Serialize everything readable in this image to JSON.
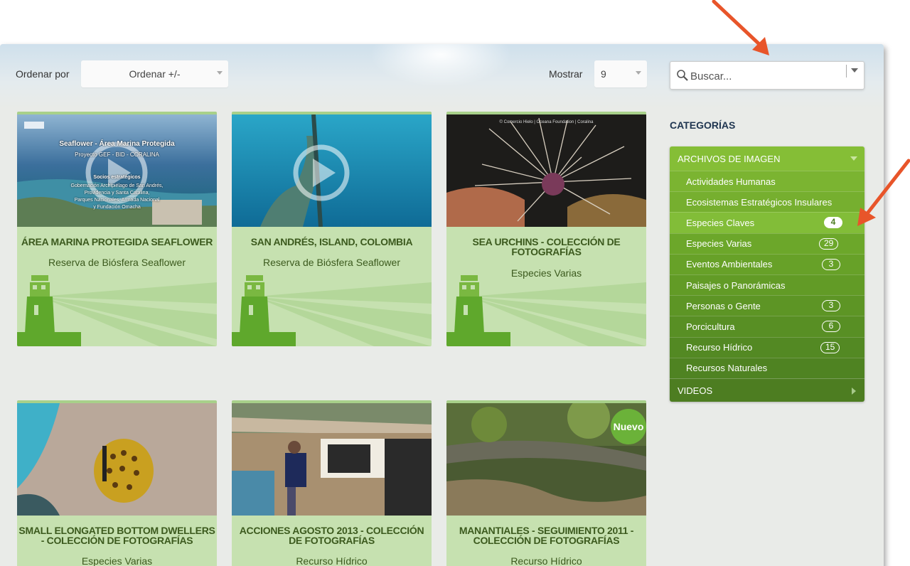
{
  "toolbar": {
    "sort_label": "Ordenar por",
    "sort_value": "Ordenar +/-",
    "show_label": "Mostrar",
    "show_value": "9",
    "search_placeholder": "Buscar..."
  },
  "sidebar": {
    "title": "CATEGORÍAS",
    "group_images": "ARCHIVOS DE IMAGEN",
    "items": [
      {
        "label": "Actividades Humanas",
        "count": ""
      },
      {
        "label": "Ecosistemas Estratégicos Insulares",
        "count": ""
      },
      {
        "label": "Especies Claves",
        "count": "4"
      },
      {
        "label": "Especies Varias",
        "count": "29"
      },
      {
        "label": "Eventos Ambientales",
        "count": "3"
      },
      {
        "label": "Paisajes o Panorámicas",
        "count": ""
      },
      {
        "label": "Personas o Gente",
        "count": "3"
      },
      {
        "label": "Porcicultura",
        "count": "6"
      },
      {
        "label": "Recurso Hídrico",
        "count": "15"
      },
      {
        "label": "Recursos Naturales",
        "count": ""
      }
    ],
    "group_videos": "VIDEOS"
  },
  "cards": [
    {
      "title": "ÁREA MARINA PROTEGIDA SEAFLOWER",
      "subtitle": "Reserva de Biósfera Seaflower",
      "overlay": {
        "title": "Seaflower - Área Marina Protegida",
        "project": "Proyecto GEF - BID - CORALINA",
        "partners_heading": "Socios estratégicos",
        "partners_1": "Gobernación Archipiélago de San Andrés,",
        "partners_2": "Providencia y Santa Catalina,",
        "partners_3": "Parques Nacionales, Armada Nacional",
        "partners_4": "y Fundación Omacha"
      }
    },
    {
      "title": "SAN ANDRÉS, ISLAND, COLOMBIA",
      "subtitle": "Reserva de Biósfera Seaflower"
    },
    {
      "title": "SEA URCHINS - COLECCIÓN DE FOTOGRAFÍAS",
      "subtitle": "Especies Varias",
      "overlay_credit": "© Comercio Hielo | Oceana Foundation | Coralina"
    },
    {
      "title": "SMALL ELONGATED BOTTOM DWELLERS - COLECCIÓN DE FOTOGRAFÍAS",
      "subtitle": "Especies Varias"
    },
    {
      "title": "ACCIONES AGOSTO 2013 - COLECCIÓN DE FOTOGRAFÍAS",
      "subtitle": "Recurso Hídrico"
    },
    {
      "title": "MANANTIALES - SEGUIMIENTO 2011 - COLECCIÓN DE FOTOGRAFÍAS",
      "subtitle": "Recurso Hídrico",
      "badge": "Nuevo"
    }
  ],
  "colors": {
    "menu_top": "#85be36",
    "menu_bottom": "#4d7d21",
    "card_bg": "#c6e1b0",
    "card_text": "#3c5a1e",
    "annotation_arrow": "#e8552a"
  }
}
